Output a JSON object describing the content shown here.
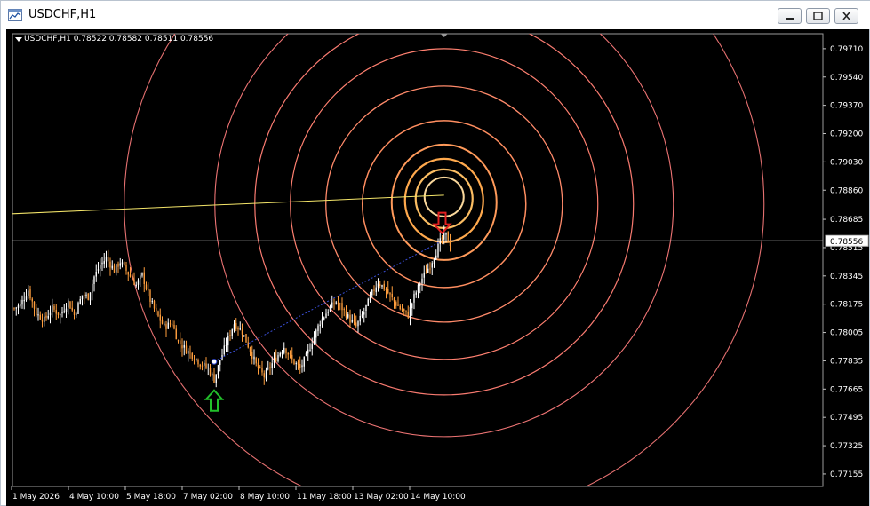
{
  "window": {
    "title": "USDCHF,H1",
    "buttons": [
      "minimize",
      "restore",
      "close"
    ]
  },
  "chart_label": {
    "symbol": "USDCHF,H1",
    "ohlc": "0.78522 0.78582 0.78511 0.78556"
  },
  "colors": {
    "background": "#000000",
    "bull_candle": "#ffffff",
    "bear_candle": "#ff9e3d",
    "price_line": "#c0c0c0",
    "trend_line_yellow": "#f5e66a",
    "dotted_line": "#3a4fd8",
    "arrow_up": "#22c02a",
    "arrow_down": "#e12020",
    "circles": [
      "#f9d79b",
      "#fbbd62",
      "#ffa94d",
      "#ff9a5a",
      "#ff8e60",
      "#ff8a6a",
      "#ff8070",
      "#f87a70",
      "#ee7474",
      "#e47070"
    ]
  },
  "chart_data": {
    "type": "candlestick",
    "symbol": "USDCHF",
    "timeframe": "H1",
    "current_price": 0.78556,
    "ylim": [
      0.7708,
      0.798
    ],
    "y_ticks": [
      "0.79710",
      "0.79540",
      "0.79370",
      "0.79200",
      "0.79030",
      "0.78860",
      "0.78685",
      "0.78515",
      "0.78345",
      "0.78175",
      "0.78005",
      "0.77835",
      "0.77665",
      "0.77495",
      "0.77325",
      "0.77155"
    ],
    "x_labels": [
      "1 May 2026",
      "4 May 10:00",
      "5 May 18:00",
      "7 May 02:00",
      "8 May 10:00",
      "11 May 18:00",
      "13 May 02:00",
      "14 May 10:00"
    ],
    "close_path": [
      [
        0,
        0.7815
      ],
      [
        3,
        0.7817
      ],
      [
        7,
        0.7826
      ],
      [
        11,
        0.7812
      ],
      [
        15,
        0.7808
      ],
      [
        19,
        0.7815
      ],
      [
        23,
        0.7811
      ],
      [
        27,
        0.7819
      ],
      [
        30,
        0.7811
      ],
      [
        34,
        0.7823
      ],
      [
        37,
        0.7822
      ],
      [
        40,
        0.7834
      ],
      [
        43,
        0.7841
      ],
      [
        46,
        0.7845
      ],
      [
        50,
        0.7838
      ],
      [
        53,
        0.7843
      ],
      [
        57,
        0.7836
      ],
      [
        61,
        0.7829
      ],
      [
        64,
        0.7835
      ],
      [
        68,
        0.782
      ],
      [
        71,
        0.7812
      ],
      [
        75,
        0.7804
      ],
      [
        79,
        0.7806
      ],
      [
        82,
        0.7795
      ],
      [
        86,
        0.779
      ],
      [
        90,
        0.7786
      ],
      [
        93,
        0.7782
      ],
      [
        97,
        0.7779
      ],
      [
        100,
        0.7772
      ],
      [
        103,
        0.7784
      ],
      [
        107,
        0.7797
      ],
      [
        110,
        0.7806
      ],
      [
        114,
        0.7801
      ],
      [
        118,
        0.779
      ],
      [
        121,
        0.7781
      ],
      [
        125,
        0.7774
      ],
      [
        128,
        0.778
      ],
      [
        132,
        0.7787
      ],
      [
        135,
        0.7792
      ],
      [
        139,
        0.7784
      ],
      [
        143,
        0.7779
      ],
      [
        146,
        0.7786
      ],
      [
        150,
        0.7798
      ],
      [
        153,
        0.7807
      ],
      [
        157,
        0.7814
      ],
      [
        161,
        0.7819
      ],
      [
        164,
        0.7815
      ],
      [
        168,
        0.7808
      ],
      [
        171,
        0.7804
      ],
      [
        175,
        0.7813
      ],
      [
        179,
        0.7824
      ],
      [
        182,
        0.7831
      ],
      [
        186,
        0.7826
      ],
      [
        190,
        0.7819
      ],
      [
        193,
        0.7815
      ],
      [
        197,
        0.7811
      ],
      [
        200,
        0.7822
      ],
      [
        204,
        0.7833
      ],
      [
        208,
        0.7841
      ],
      [
        211,
        0.7849
      ],
      [
        213,
        0.7855
      ],
      [
        216,
        0.7859
      ],
      [
        218,
        0.7854
      ]
    ],
    "entries": [
      {
        "type": "buy",
        "label": "up arrow",
        "t": 100,
        "price": 0.777,
        "entry_price": 0.7783
      },
      {
        "type": "sell",
        "label": "down arrow",
        "t": 214,
        "price": 0.7873
      }
    ],
    "lines": [
      {
        "name": "yellow trendline",
        "from": [
          -75,
          0.7868
        ],
        "to": [
          215,
          0.7883
        ]
      },
      {
        "name": "dotted connector",
        "from": [
          100,
          0.7783
        ],
        "to": [
          213,
          0.7855
        ]
      }
    ],
    "circles_center": {
      "t": 215,
      "price": 0.7883
    },
    "circle_count": 10
  }
}
